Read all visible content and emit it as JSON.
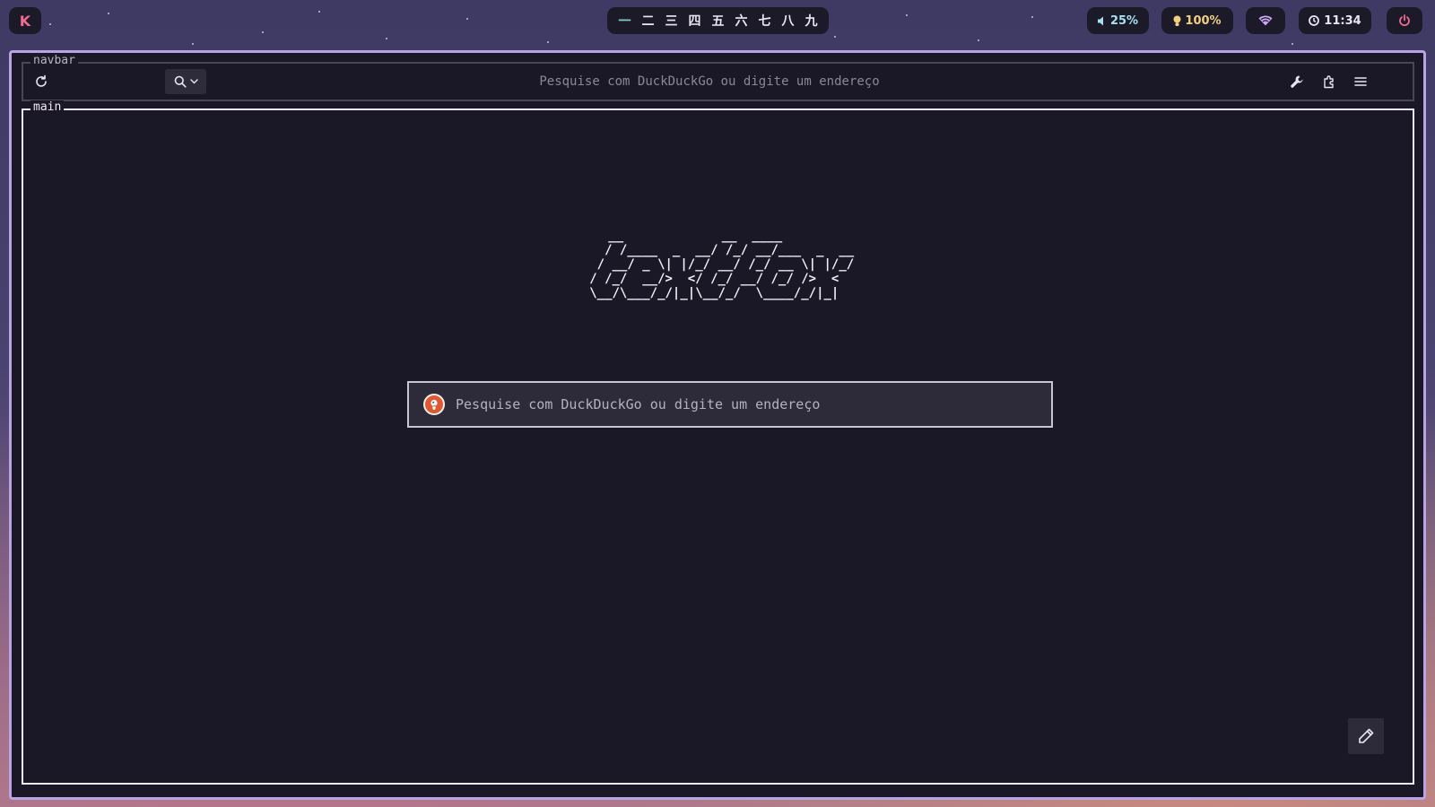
{
  "topbar": {
    "launcher_label": "K",
    "workspaces": [
      "一",
      "二",
      "三",
      "四",
      "五",
      "六",
      "七",
      "八",
      "九"
    ],
    "active_workspace": 0,
    "volume": "25%",
    "brightness": "100%",
    "clock": "11:34",
    "icons": {
      "volume": "speaker-icon",
      "brightness": "bulb-icon",
      "wifi": "wifi-icon",
      "clock": "clock-icon",
      "power": "power-icon"
    }
  },
  "browser": {
    "navbar_label": "navbar",
    "main_label": "main",
    "url_placeholder": "Pesquise com DuckDuckGo ou digite um endereço",
    "logo_ascii": "    __             __  ____          \n   / /____  _  __/ /_/ __/___  _  __\n  / __/ _ \\| |/_/ __/ /_/ __ \\| |/_/\n / /_/  __/>  </ /_/ __/ /_/ />  <  \n \\__/\\___/_/|_|\\__/_/  \\____/_/|_|  ",
    "search_placeholder": "Pesquise com DuckDuckGo ou digite um endereço",
    "search_engine_icon": "duckduckgo-icon"
  },
  "colors": {
    "accent_frame": "#b9a3e3",
    "background": "#1a1826",
    "launcher": "#f06b8c",
    "volume": "#a6e0f0",
    "brightness": "#f2cf7e",
    "wifi": "#c9a7f5",
    "active_workspace": "#7fd4c8"
  }
}
